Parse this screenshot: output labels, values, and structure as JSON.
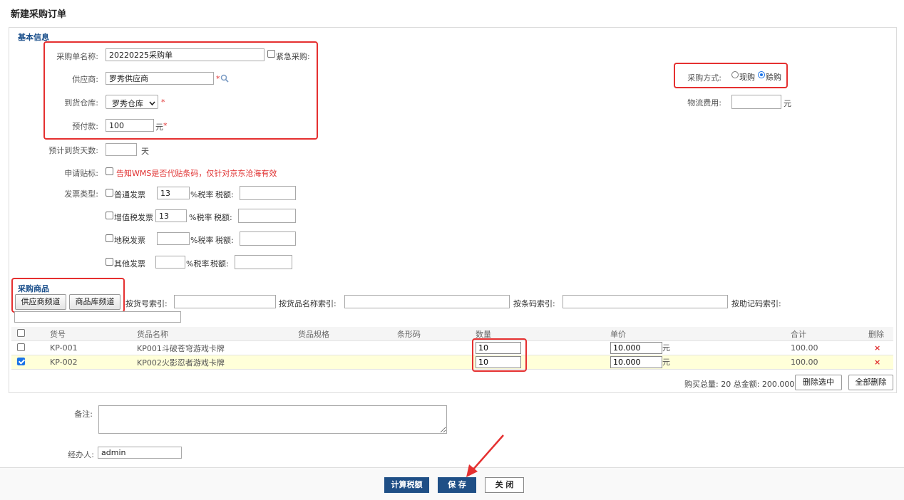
{
  "page": {
    "title": "新建采购订单"
  },
  "basic": {
    "section_title": "基本信息",
    "order_name_label": "采购单名称:",
    "order_name_value": "20220225采购单",
    "urgent_label": "紧急采购:",
    "supplier_label": "供应商:",
    "supplier_value": "罗秀供应商",
    "warehouse_label": "到货仓库:",
    "warehouse_value": "罗秀仓库",
    "prepay_label": "预付款:",
    "prepay_value": "100",
    "yuan": "元",
    "required_mark": "*",
    "eta_label": "预计到货天数:",
    "eta_value": "",
    "day_unit": "天",
    "label_apply_label": "申请贴标:",
    "label_apply_note": "告知WMS是否代贴条码，仅针对京东沧海有效",
    "invoice_label": "发票类型:",
    "invoices": [
      {
        "name": "普通发票",
        "rate": "13",
        "rate_text": "%税率",
        "tax_label": "税额:"
      },
      {
        "name": "增值税发票",
        "rate": "13",
        "rate_text": "%税率",
        "tax_label": "税额:"
      },
      {
        "name": "地税发票",
        "rate": "",
        "rate_text": "%税率",
        "tax_label": "税额:"
      },
      {
        "name": "其他发票",
        "rate": "",
        "rate_text": "%税率",
        "tax_label": "税额:"
      }
    ],
    "purchase_mode_label": "采购方式:",
    "mode_cash": "现购",
    "mode_credit": "赊购",
    "logistics_label": "物流费用:",
    "logistics_value": ""
  },
  "goods": {
    "section_title": "采购商品",
    "btn_supplier_channel": "供应商频道",
    "btn_library_channel": "商品库频道",
    "search_code_label": "按货号索引:",
    "search_name_label": "按货品名称索引:",
    "search_barcode_label": "按条码索引:",
    "search_memo_label": "按助记码索引:",
    "columns": [
      "货号",
      "货品名称",
      "货品规格",
      "条形码",
      "数量",
      "单价",
      "合计",
      "删除"
    ],
    "rows": [
      {
        "code": "KP-001",
        "name": "KP001斗破苍穹游戏卡牌",
        "spec": "",
        "barcode": "",
        "qty": "10",
        "price": "10.000",
        "unit": "元",
        "total": "100.00",
        "checked": false
      },
      {
        "code": "KP-002",
        "name": "KP002火影忍者游戏卡牌",
        "spec": "",
        "barcode": "",
        "qty": "10",
        "price": "10.000",
        "unit": "元",
        "total": "100.00",
        "checked": true
      }
    ],
    "delete_mark": "×",
    "summary": "购买总量: 20 总金额: 200.000",
    "btn_delete_selected": "删除选中",
    "btn_delete_all": "全部删除"
  },
  "remark": {
    "label": "备注:",
    "value": ""
  },
  "handler": {
    "label": "经办人:",
    "value": "admin"
  },
  "footer": {
    "btn_calc": "计算税额",
    "btn_save": "保 存",
    "btn_close": "关 闭"
  }
}
